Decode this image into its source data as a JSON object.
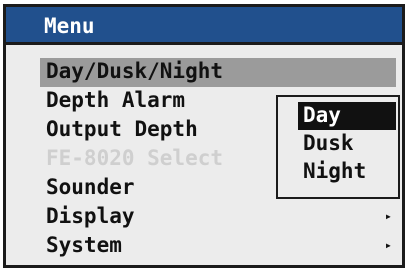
{
  "menu": {
    "title": "Menu",
    "items": [
      {
        "label": "Day/Dusk/Night",
        "arrow": ""
      },
      {
        "label": "Depth Alarm",
        "arrow": ""
      },
      {
        "label": "Output Depth",
        "arrow": ""
      },
      {
        "label": "FE-8020 Select",
        "arrow": ""
      },
      {
        "label": "Sounder",
        "arrow": ""
      },
      {
        "label": "Display",
        "arrow": "▸"
      },
      {
        "label": "System",
        "arrow": "▸"
      }
    ]
  },
  "submenu": {
    "items": [
      {
        "label": "Day"
      },
      {
        "label": "Dusk"
      },
      {
        "label": "Night"
      }
    ]
  },
  "colors": {
    "titlebar": "#21508d",
    "panel": "#ececec",
    "highlight": "#9b9b9b",
    "disabled_text": "#cfcfcf",
    "selected_option": "#111111"
  }
}
